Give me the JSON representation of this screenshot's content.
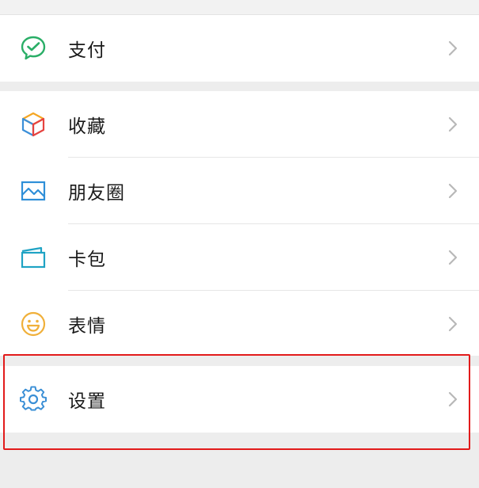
{
  "menu": {
    "pay": {
      "label": "支付",
      "icon": "wechat-pay-icon"
    },
    "favorites": {
      "label": "收藏",
      "icon": "cube-favorites-icon"
    },
    "moments": {
      "label": "朋友圈",
      "icon": "image-moments-icon"
    },
    "cards": {
      "label": "卡包",
      "icon": "card-wallet-icon"
    },
    "stickers": {
      "label": "表情",
      "icon": "smiley-icon"
    },
    "settings": {
      "label": "设置",
      "icon": "gear-icon"
    }
  },
  "colors": {
    "pay_green": "#2aae67",
    "favorites_orange": "#f5a623",
    "favorites_blue": "#3b8fd9",
    "favorites_red": "#e64340",
    "moments_blue": "#2f8fd8",
    "cards_teal": "#1fa3c4",
    "stickers_gold": "#f0b03a",
    "settings_blue": "#3a8fd6",
    "highlight_red": "#e21b1b",
    "chevron_gray": "#b8b8b8"
  }
}
